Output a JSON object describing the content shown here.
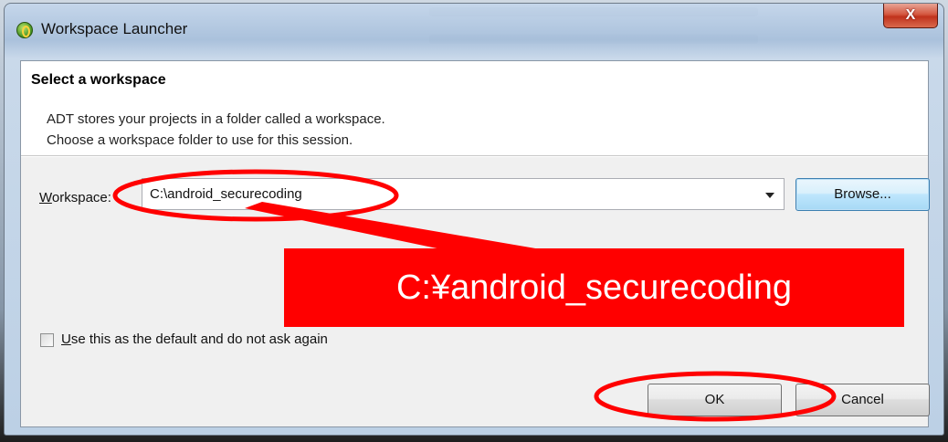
{
  "window": {
    "title": "Workspace Launcher",
    "close_label": "X"
  },
  "banner": {
    "title": "Select a workspace",
    "line1": "ADT stores your projects in a folder called a workspace.",
    "line2": "Choose a workspace folder to use for this session."
  },
  "workspace": {
    "label_mnemonic": "W",
    "label_rest": "orkspace:",
    "value": "C:\\android_securecoding",
    "browse_label": "Browse..."
  },
  "default_option": {
    "label_mnemonic": "U",
    "label_rest": "se this as the default and do not ask again",
    "checked": false
  },
  "buttons": {
    "ok_label": "OK",
    "cancel_label": "Cancel"
  },
  "annotation": {
    "callout_text": "C:¥android_securecoding",
    "color": "#ff0000"
  },
  "icons": {
    "app": "adt-app-icon",
    "dropdown": "chevron-down-icon"
  }
}
